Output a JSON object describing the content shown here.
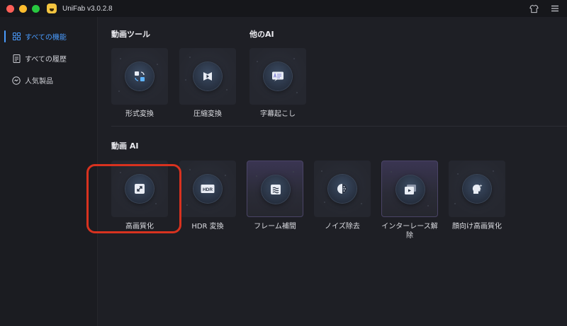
{
  "app": {
    "title": "UniFab v3.0.2.8"
  },
  "sidebar": {
    "items": [
      {
        "label": "すべての機能",
        "icon": "grid-icon",
        "active": true
      },
      {
        "label": "すべての履歴",
        "icon": "history-list-icon",
        "active": false
      },
      {
        "label": "人気製品",
        "icon": "popular-badge-icon",
        "active": false
      }
    ]
  },
  "sections": {
    "video_tools": {
      "title": "動画ツール",
      "tools": [
        {
          "label": "形式変換",
          "icon": "format-convert-icon"
        },
        {
          "label": "圧縮変換",
          "icon": "compress-icon"
        }
      ]
    },
    "other_ai": {
      "title": "他のAI",
      "tools": [
        {
          "label": "字幕起こし",
          "icon": "subtitle-icon"
        }
      ]
    },
    "video_ai": {
      "title": "動画 AI",
      "tools": [
        {
          "label": "高画質化",
          "icon": "upscale-icon"
        },
        {
          "label": "HDR 変換",
          "icon": "hdr-icon",
          "badge": "HDR"
        },
        {
          "label": "フレーム補間",
          "icon": "frame-interpolation-icon"
        },
        {
          "label": "ノイズ除去",
          "icon": "denoise-icon"
        },
        {
          "label": "インターレース解除",
          "icon": "deinterlace-icon"
        },
        {
          "label": "顔向け高画質化",
          "icon": "face-enhance-icon"
        }
      ]
    }
  },
  "colors": {
    "accent": "#4a9cff",
    "highlight_ring": "#d8321f",
    "background": "#1e1f25",
    "sidebar": "#1b1c21"
  }
}
